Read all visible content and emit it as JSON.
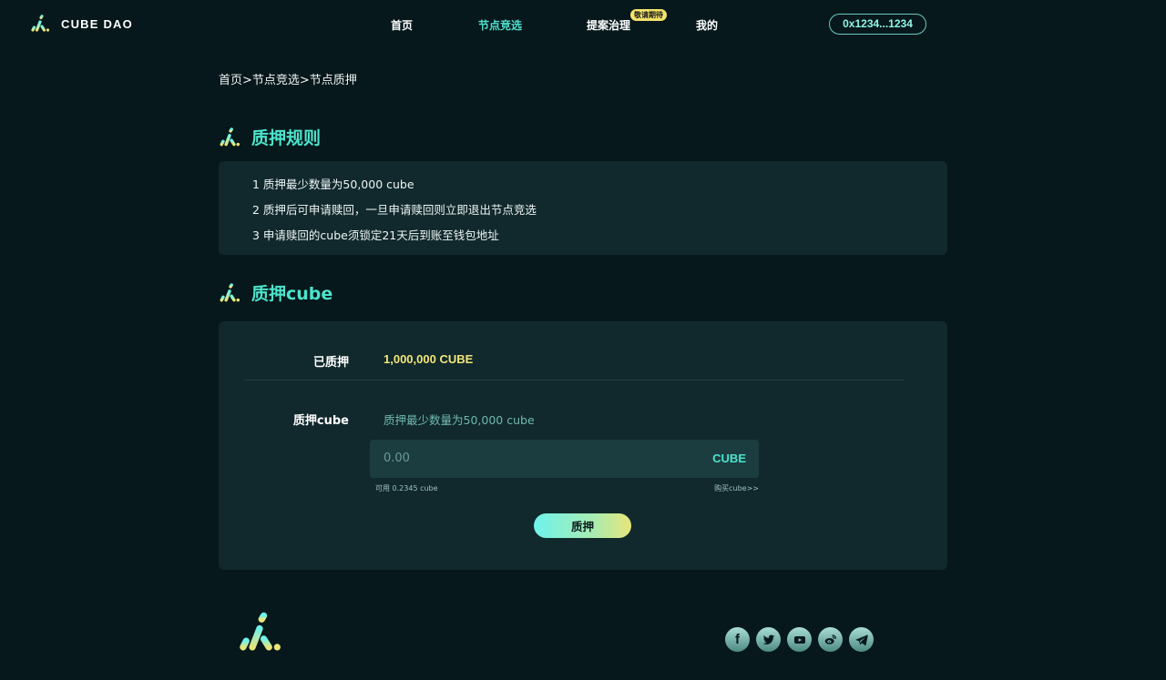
{
  "brand": {
    "name": "CUBE DAO",
    "logo_icon": "cube-dao-logo-icon"
  },
  "nav": {
    "items": [
      {
        "label": "首页",
        "active": false
      },
      {
        "label": "节点竞选",
        "active": true
      },
      {
        "label": "提案治理",
        "active": false,
        "badge": "敬请期待"
      },
      {
        "label": "我的",
        "active": false
      }
    ]
  },
  "wallet": {
    "address": "0x1234...1234"
  },
  "breadcrumb": "首页>节点竞选>节点质押",
  "rules": {
    "title": "质押规则",
    "items": [
      "1 质押最少数量为50,000 cube",
      "2 质押后可申请赎回，一旦申请赎回则立即退出节点竞选",
      "3 申请赎回的cube须锁定21天后到账至钱包地址"
    ]
  },
  "stake": {
    "title": "质押cube",
    "staked_label": "已质押",
    "staked_value": "1,000,000 CUBE",
    "input_label": "质押cube",
    "hint": "质押最少数量为50,000 cube",
    "input_value": "0.00",
    "input_unit": "CUBE",
    "available": "可用 0.2345 cube",
    "buy_link": "购买cube>>",
    "submit_label": "质押"
  },
  "footer": {
    "logo_icon": "cube-dao-logo-icon",
    "socials": [
      "facebook-icon",
      "twitter-icon",
      "youtube-icon",
      "weibo-icon",
      "telegram-icon"
    ]
  },
  "colors": {
    "background": "#06181b",
    "card": "#11292c",
    "accent": "#4ce3cc",
    "highlight": "#f2e57a",
    "badge": "#f4e46b"
  }
}
